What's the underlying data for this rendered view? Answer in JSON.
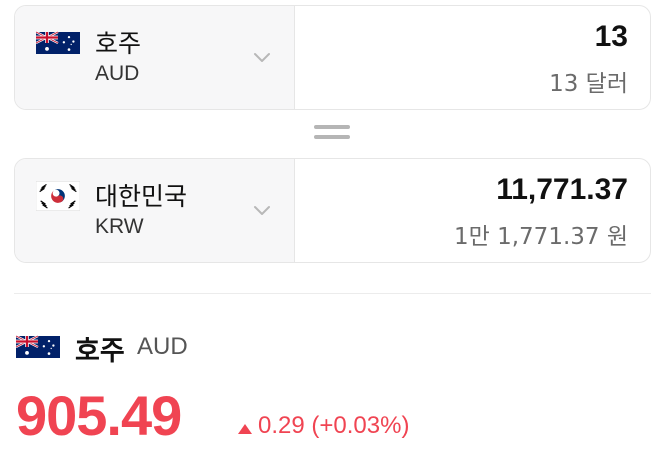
{
  "from": {
    "flag_icon": "australia-flag-icon",
    "country": "호주",
    "code": "AUD",
    "amount": "13",
    "amount_words": "13 달러"
  },
  "equals_icon": "equals-icon",
  "to": {
    "flag_icon": "south-korea-flag-icon",
    "country": "대한민국",
    "code": "KRW",
    "amount": "11,771.37",
    "amount_words": "1만 1,771.37 원"
  },
  "rate_detail": {
    "flag_icon": "australia-flag-icon",
    "country": "호주",
    "code": "AUD",
    "rate": "905.49",
    "change": "0.29 (+0.03%)",
    "change_direction": "up",
    "accent_color": "#f04452"
  }
}
